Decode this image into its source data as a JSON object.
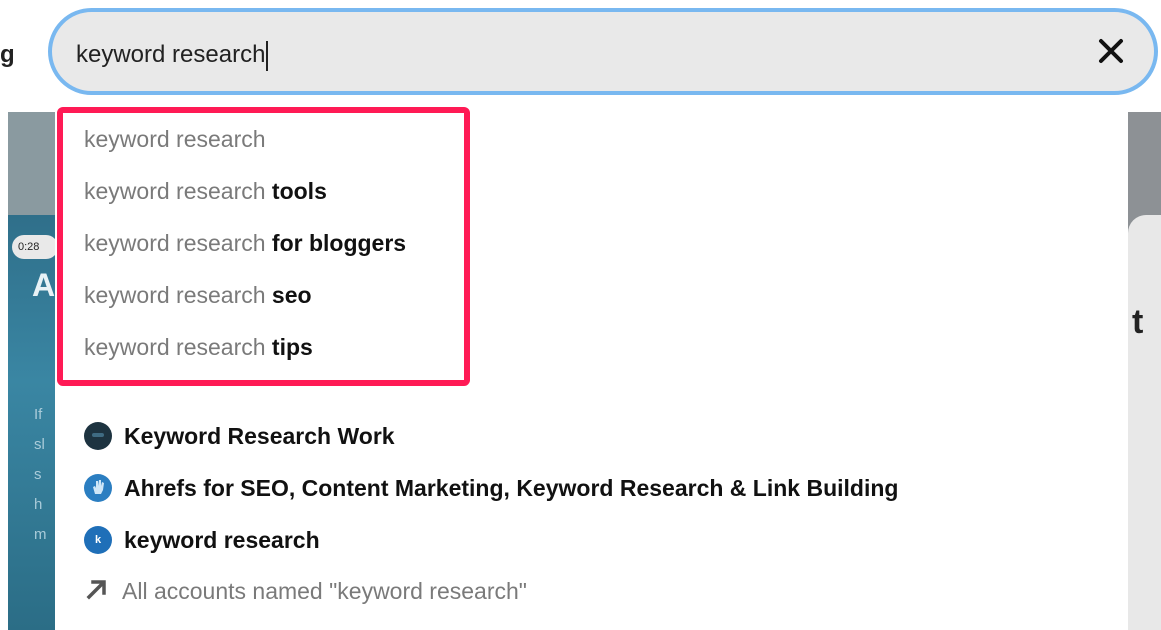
{
  "search": {
    "value": "keyword research"
  },
  "suggestions": [
    {
      "prefix": "keyword research",
      "suffix": ""
    },
    {
      "prefix": "keyword research",
      "suffix": "tools"
    },
    {
      "prefix": "keyword research",
      "suffix": "for bloggers"
    },
    {
      "prefix": "keyword research",
      "suffix": "seo"
    },
    {
      "prefix": "keyword research",
      "suffix": "tips"
    }
  ],
  "accounts": [
    {
      "name": "Keyword Research Work",
      "avatar_color": "#1d3340",
      "avatar_icon": "dark-logo-icon"
    },
    {
      "name": "Ahrefs for SEO, Content Marketing, Keyword Research & Link Building",
      "avatar_color": "#2b7ec1",
      "avatar_icon": "hand-icon"
    },
    {
      "name": "keyword research",
      "avatar_color": "#1f6fb8",
      "avatar_letter": "k"
    }
  ],
  "all_accounts": {
    "label": "All accounts named \"keyword research\"",
    "icon": "arrow-up-right-icon"
  },
  "background": {
    "left_glyph": "g",
    "video_time": "0:28",
    "video_letter": "A",
    "video_faint_lines": [
      "If",
      "sl",
      "s",
      "h",
      "m"
    ],
    "right_glyph": "t"
  },
  "colors": {
    "search_border": "#79b8f0",
    "highlight": "#ff1a55"
  }
}
